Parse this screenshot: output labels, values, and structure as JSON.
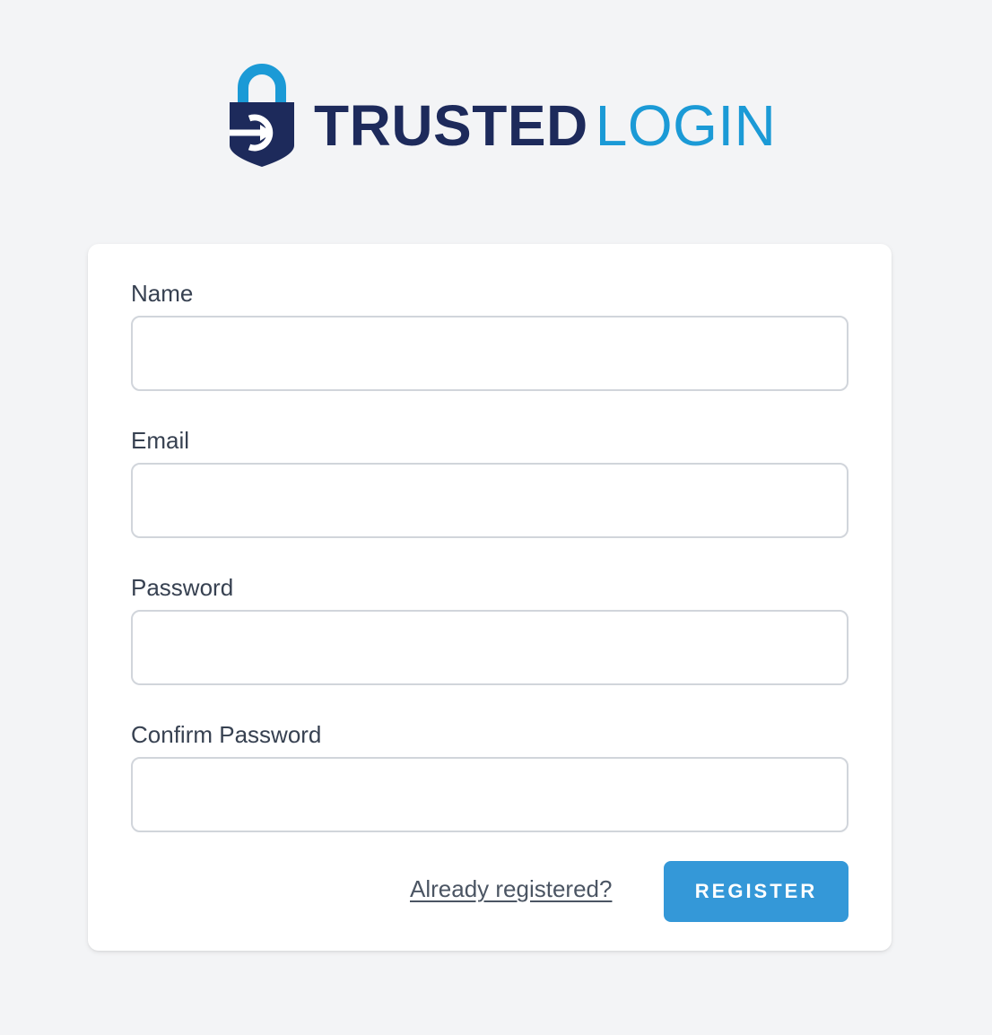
{
  "brand": {
    "wordmark_bold": "TRUSTED",
    "wordmark_light": "LOGIN",
    "color_dark": "#1d2a5b",
    "color_light": "#1b9ad6"
  },
  "form": {
    "fields": [
      {
        "label": "Name",
        "value": "",
        "placeholder": ""
      },
      {
        "label": "Email",
        "value": "",
        "placeholder": ""
      },
      {
        "label": "Password",
        "value": "",
        "placeholder": ""
      },
      {
        "label": "Confirm Password",
        "value": "",
        "placeholder": ""
      }
    ],
    "login_link": "Already registered?",
    "submit_label": "REGISTER",
    "accent_color": "#3498d8"
  }
}
